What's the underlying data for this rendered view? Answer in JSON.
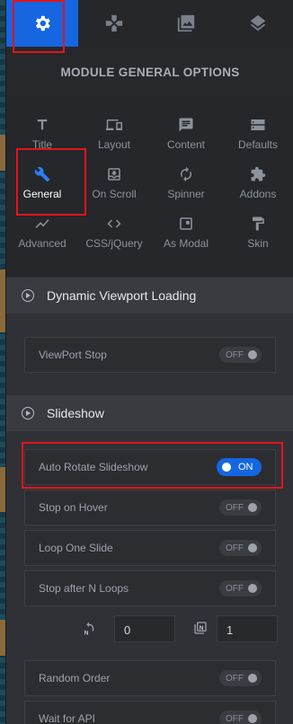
{
  "top_tabs": [
    {
      "icon": "gear-icon",
      "active": true
    },
    {
      "icon": "gamepad-icon",
      "active": false
    },
    {
      "icon": "library-icon",
      "active": false
    },
    {
      "icon": "layers-icon",
      "active": false
    }
  ],
  "header": {
    "title": "MODULE GENERAL OPTIONS"
  },
  "options_grid": [
    {
      "label": "Title",
      "icon": "title-icon",
      "active": false
    },
    {
      "label": "Layout",
      "icon": "devices-icon",
      "active": false
    },
    {
      "label": "Content",
      "icon": "comment-icon",
      "active": false
    },
    {
      "label": "Defaults",
      "icon": "storage-icon",
      "active": false
    },
    {
      "label": "General",
      "icon": "wrench-icon",
      "active": true
    },
    {
      "label": "On Scroll",
      "icon": "download-box-icon",
      "active": false
    },
    {
      "label": "Spinner",
      "icon": "refresh-icon",
      "active": false
    },
    {
      "label": "Addons",
      "icon": "puzzle-icon",
      "active": false
    },
    {
      "label": "Advanced",
      "icon": "trending-icon",
      "active": false
    },
    {
      "label": "CSS/jQuery",
      "icon": "code-icon",
      "active": false
    },
    {
      "label": "As Modal",
      "icon": "modal-icon",
      "active": false
    },
    {
      "label": "Skin",
      "icon": "paint-roller-icon",
      "active": false
    }
  ],
  "sections": {
    "viewport": {
      "title": "Dynamic Viewport Loading",
      "rows": [
        {
          "label": "ViewPort Stop",
          "state": "OFF"
        }
      ]
    },
    "slideshow": {
      "title": "Slideshow",
      "rows": [
        {
          "label": "Auto Rotate Slideshow",
          "state": "ON"
        },
        {
          "label": "Stop on Hover",
          "state": "OFF"
        },
        {
          "label": "Loop One Slide",
          "state": "OFF"
        },
        {
          "label": "Stop after N Loops",
          "state": "OFF"
        }
      ],
      "loop_inputs": {
        "loops_value": "0",
        "slide_value": "1"
      },
      "rows2": [
        {
          "label": "Random Order",
          "state": "OFF"
        },
        {
          "label": "Wait for API",
          "state": "OFF"
        }
      ]
    }
  },
  "colors": {
    "accent": "#1566e0",
    "highlight": "#e3141a",
    "panel": "#2f3136"
  }
}
